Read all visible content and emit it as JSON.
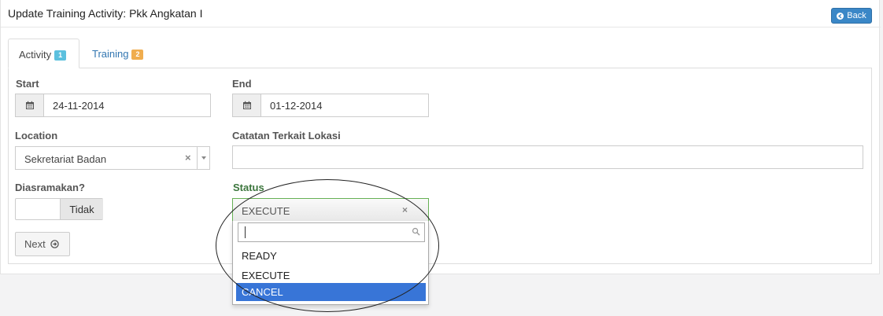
{
  "header": {
    "title": "Update Training Activity: Pkk Angkatan I",
    "back_label": "Back"
  },
  "tabs": [
    {
      "label": "Activity",
      "badge": "1",
      "active": true
    },
    {
      "label": "Training",
      "badge": "2",
      "active": false
    }
  ],
  "form": {
    "start": {
      "label": "Start",
      "value": "24-11-2014"
    },
    "end": {
      "label": "End",
      "value": "01-12-2014"
    },
    "location": {
      "label": "Location",
      "value": "Sekretariat Badan",
      "clear": "×"
    },
    "location_note": {
      "label": "Catatan Terkait Lokasi",
      "value": ""
    },
    "dormitory": {
      "label": "Diasramakan?",
      "toggle_value": "Tidak"
    },
    "status": {
      "label": "Status",
      "value": "EXECUTE",
      "clear": "×"
    },
    "next_label": "Next"
  },
  "status_dropdown": {
    "search_value": "",
    "options": [
      "READY",
      "EXECUTE",
      "CANCEL"
    ],
    "highlighted": "CANCEL"
  },
  "colors": {
    "primary": "#3a87c7",
    "badge_blue": "#5bc0de",
    "badge_orange": "#f0ad4e",
    "status_green": "#3c763d",
    "highlight": "#3875d7"
  },
  "icons": [
    "arrow-left-icon",
    "calendar-icon",
    "arrow-circle-right-icon",
    "search-icon",
    "chevron-down-icon"
  ]
}
